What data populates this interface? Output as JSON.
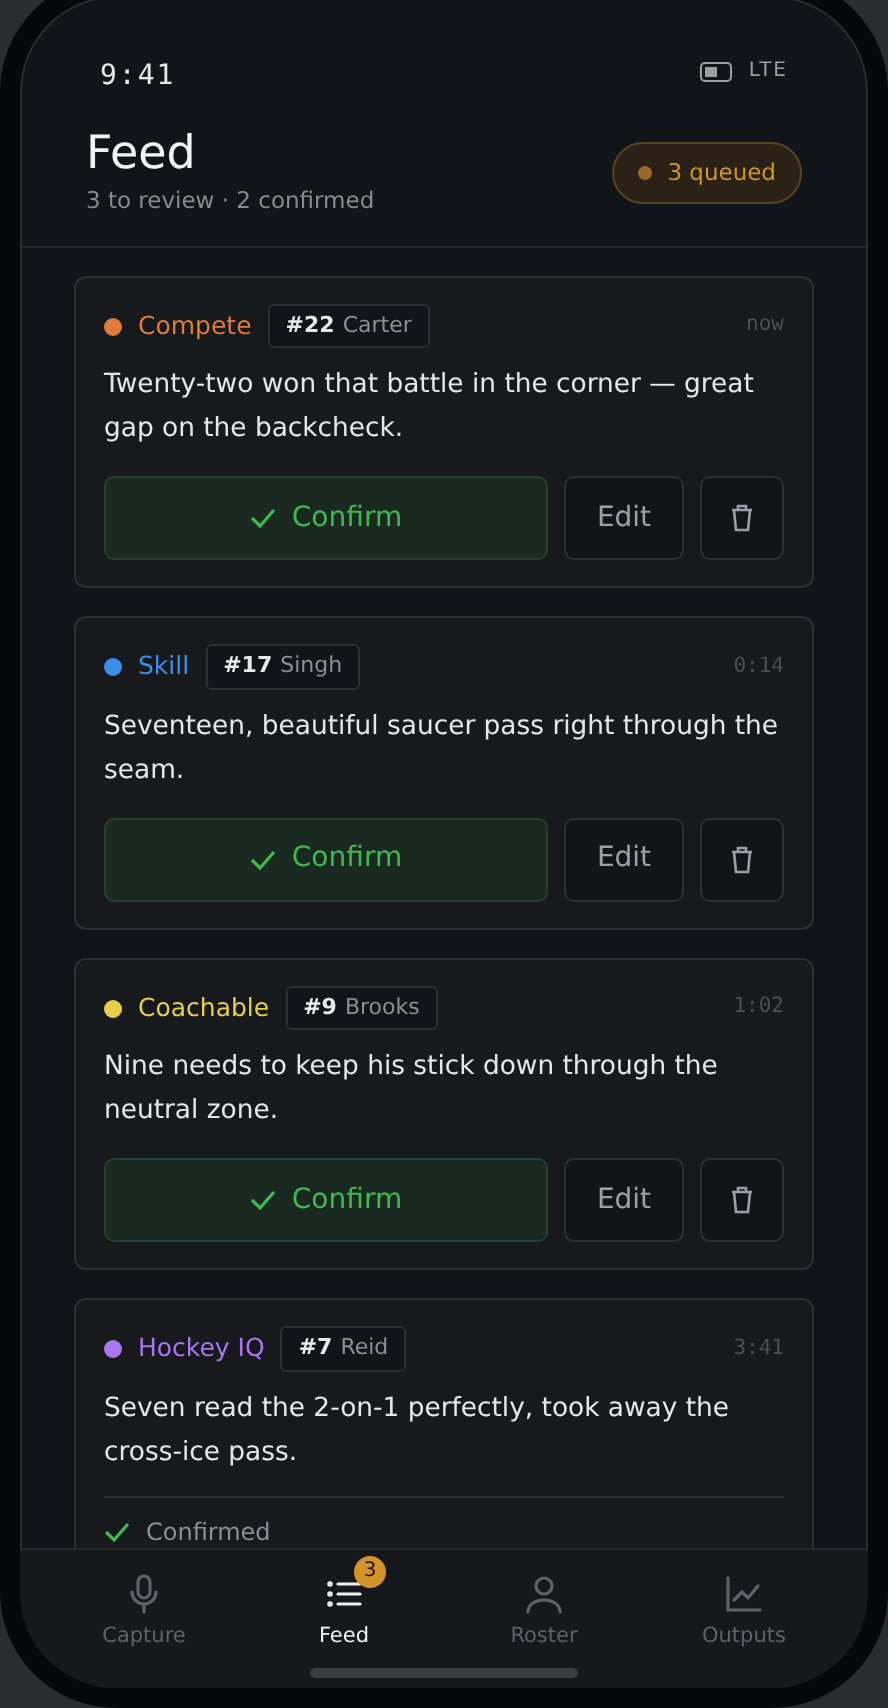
{
  "status_bar": {
    "time": "9:41",
    "network": "LTE"
  },
  "header": {
    "title": "Feed",
    "subtitle": "3 to review · 2 confirmed",
    "queue_badge": "3 queued"
  },
  "feed": [
    {
      "category": "Compete",
      "color": "#e07b39",
      "player_number": "#22",
      "player_name": "Carter",
      "time": "now",
      "text": "Twenty-two won that battle in the corner — great gap on the backcheck.",
      "confirmed": false,
      "confirm_label": "Confirm",
      "edit_label": "Edit"
    },
    {
      "category": "Skill",
      "color": "#3b8eea",
      "player_number": "#17",
      "player_name": "Singh",
      "time": "0:14",
      "text": "Seventeen, beautiful saucer pass right through the seam.",
      "confirmed": false,
      "confirm_label": "Confirm",
      "edit_label": "Edit"
    },
    {
      "category": "Coachable",
      "color": "#e8cf4a",
      "player_number": "#9",
      "player_name": "Brooks",
      "time": "1:02",
      "text": "Nine needs to keep his stick down through the neutral zone.",
      "confirmed": false,
      "confirm_label": "Confirm",
      "edit_label": "Edit"
    },
    {
      "category": "Hockey IQ",
      "color": "#a877f0",
      "player_number": "#7",
      "player_name": "Reid",
      "time": "3:41",
      "text": "Seven read the 2-on-1 perfectly, took away the cross-ice pass.",
      "confirmed": true,
      "status_label": "Confirmed"
    }
  ],
  "tab_bar": [
    {
      "label": "Capture",
      "selected": false
    },
    {
      "label": "Feed",
      "selected": true,
      "badge": "3"
    },
    {
      "label": "Roster",
      "selected": false
    },
    {
      "label": "Outputs",
      "selected": false
    }
  ]
}
